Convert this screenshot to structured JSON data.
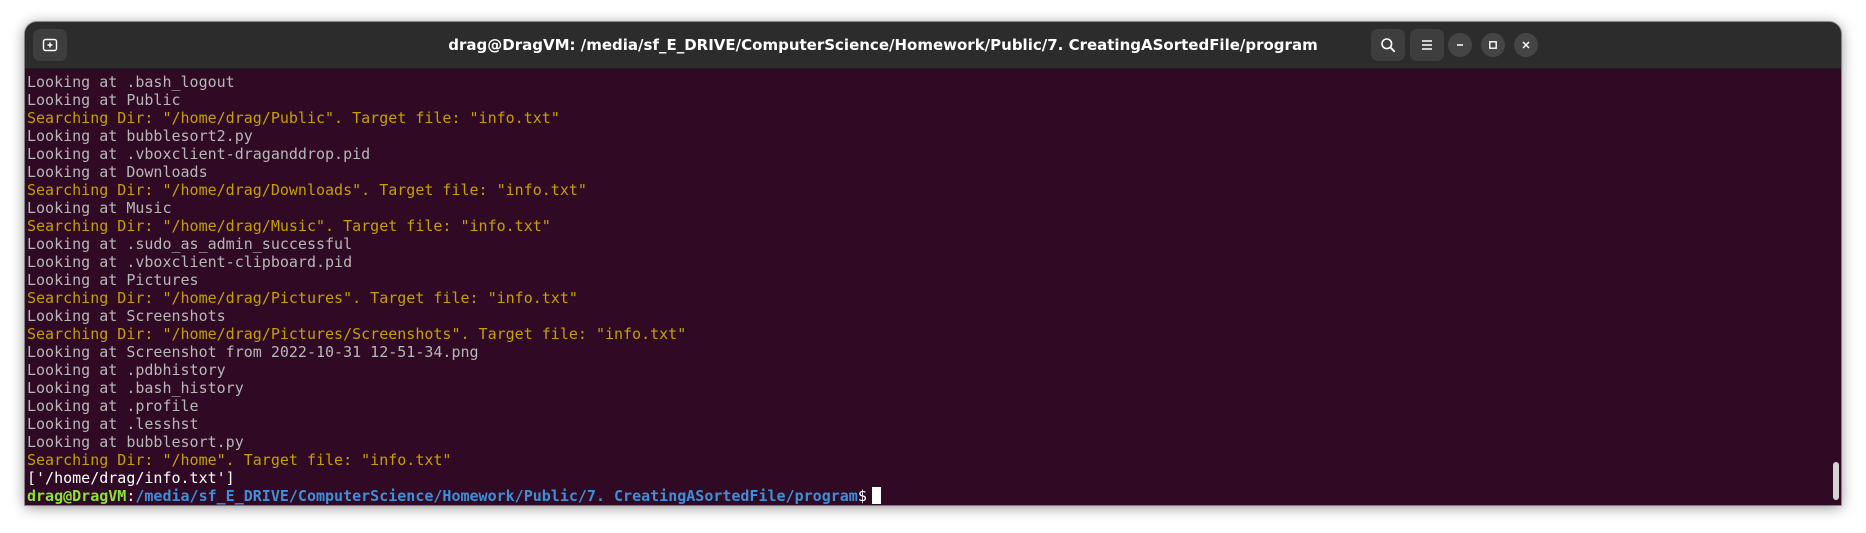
{
  "window": {
    "title": "drag@DragVM: /media/sf_E_DRIVE/ComputerScience/Homework/Public/7. CreatingASortedFile/program",
    "icons": {
      "new_tab": "new-tab-icon",
      "search": "search-icon",
      "menu": "hamburger-menu-icon",
      "minimize": "minimize-icon",
      "maximize": "maximize-icon",
      "close": "close-icon"
    }
  },
  "colors": {
    "terminal_bg": "#300a24",
    "output_text": "#b7b7b7",
    "search_text": "#c4a000",
    "prompt_user": "#8ae234",
    "prompt_path": "#3d8fd9",
    "titlebar_bg": "#2c2c2c"
  },
  "terminal": {
    "lines": [
      {
        "type": "out",
        "text": "Looking at .bash_logout"
      },
      {
        "type": "out",
        "text": "Looking at Public"
      },
      {
        "type": "search",
        "text": "Searching Dir: \"/home/drag/Public\". Target file: \"info.txt\""
      },
      {
        "type": "out",
        "text": "Looking at bubblesort2.py"
      },
      {
        "type": "out",
        "text": "Looking at .vboxclient-draganddrop.pid"
      },
      {
        "type": "out",
        "text": "Looking at Downloads"
      },
      {
        "type": "search",
        "text": "Searching Dir: \"/home/drag/Downloads\". Target file: \"info.txt\""
      },
      {
        "type": "out",
        "text": "Looking at Music"
      },
      {
        "type": "search",
        "text": "Searching Dir: \"/home/drag/Music\". Target file: \"info.txt\""
      },
      {
        "type": "out",
        "text": "Looking at .sudo_as_admin_successful"
      },
      {
        "type": "out",
        "text": "Looking at .vboxclient-clipboard.pid"
      },
      {
        "type": "out",
        "text": "Looking at Pictures"
      },
      {
        "type": "search",
        "text": "Searching Dir: \"/home/drag/Pictures\". Target file: \"info.txt\""
      },
      {
        "type": "out",
        "text": "Looking at Screenshots"
      },
      {
        "type": "search",
        "text": "Searching Dir: \"/home/drag/Pictures/Screenshots\". Target file: \"info.txt\""
      },
      {
        "type": "out",
        "text": "Looking at Screenshot from 2022-10-31 12-51-34.png"
      },
      {
        "type": "out",
        "text": "Looking at .pdbhistory"
      },
      {
        "type": "out",
        "text": "Looking at .bash_history"
      },
      {
        "type": "out",
        "text": "Looking at .profile"
      },
      {
        "type": "out",
        "text": "Looking at .lesshst"
      },
      {
        "type": "out",
        "text": "Looking at bubblesort.py"
      },
      {
        "type": "search",
        "text": "Searching Dir: \"/home\". Target file: \"info.txt\""
      },
      {
        "type": "result",
        "text": "['/home/drag/info.txt']"
      }
    ],
    "prompt": {
      "user": "drag@DragVM",
      "colon": ":",
      "path": "/media/sf_E_DRIVE/ComputerScience/Homework/Public/7. CreatingASortedFile/program",
      "dollar": "$"
    }
  }
}
